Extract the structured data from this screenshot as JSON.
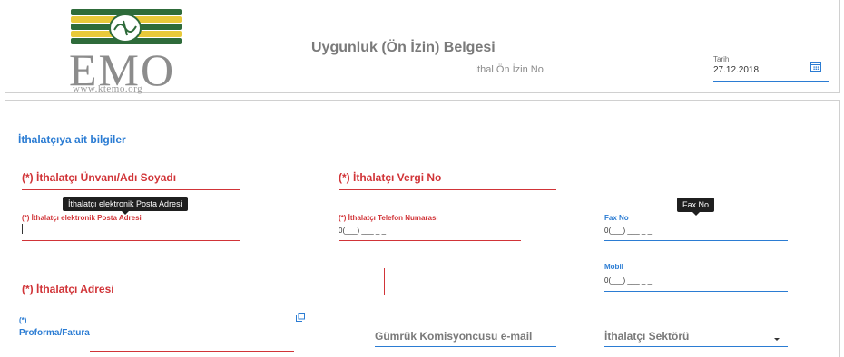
{
  "header": {
    "logo": {
      "text": "EMO",
      "url": "www.ktemo.org",
      "stripe_colors": [
        "#2e6b3a",
        "#e8c93a"
      ]
    },
    "title": "Uygunluk (Ön İzin) Belgesi",
    "import_permit_label": "İthal Ön İzin No",
    "date_label": "Tarih",
    "date_value": "27.12.2018",
    "calendar_icon": "calendar-icon"
  },
  "form": {
    "section_title": "İthalatçıya ait bilgiler",
    "fields": {
      "name": {
        "label": "(*) İthalatçı Ünvanı/Adı Soyadı"
      },
      "tax_no": {
        "label": "(*) İthalatçı Vergi No"
      },
      "email": {
        "label": "(*) İthalatçı elektronik Posta Adresi",
        "tooltip": "İthalatçı elektronik Posta Adresi"
      },
      "phone": {
        "label": "(*) İthalatçı Telefon Numarası",
        "mask": "0(___) ___ _ _"
      },
      "fax": {
        "label": "Fax No",
        "tooltip": "Fax No",
        "mask": "0(___) ___ _ _"
      },
      "mobile": {
        "label": "Mobil",
        "mask": "0(___) ___ _ _"
      },
      "address": {
        "label": "(*) İthalatçı Adresi"
      },
      "invoice": {
        "label_prefix": "(*)",
        "label": "Proforma/Fatura",
        "icon": "expand-icon"
      },
      "customs_email": {
        "placeholder": "Gümrük Komisyoncusu e-mail"
      },
      "sector": {
        "placeholder": "İthalatçı Sektörü",
        "icon": "chevron-down-icon"
      }
    }
  },
  "colors": {
    "required": "#d13438",
    "accent": "#2b7cd3",
    "muted": "#7a7a7a"
  }
}
